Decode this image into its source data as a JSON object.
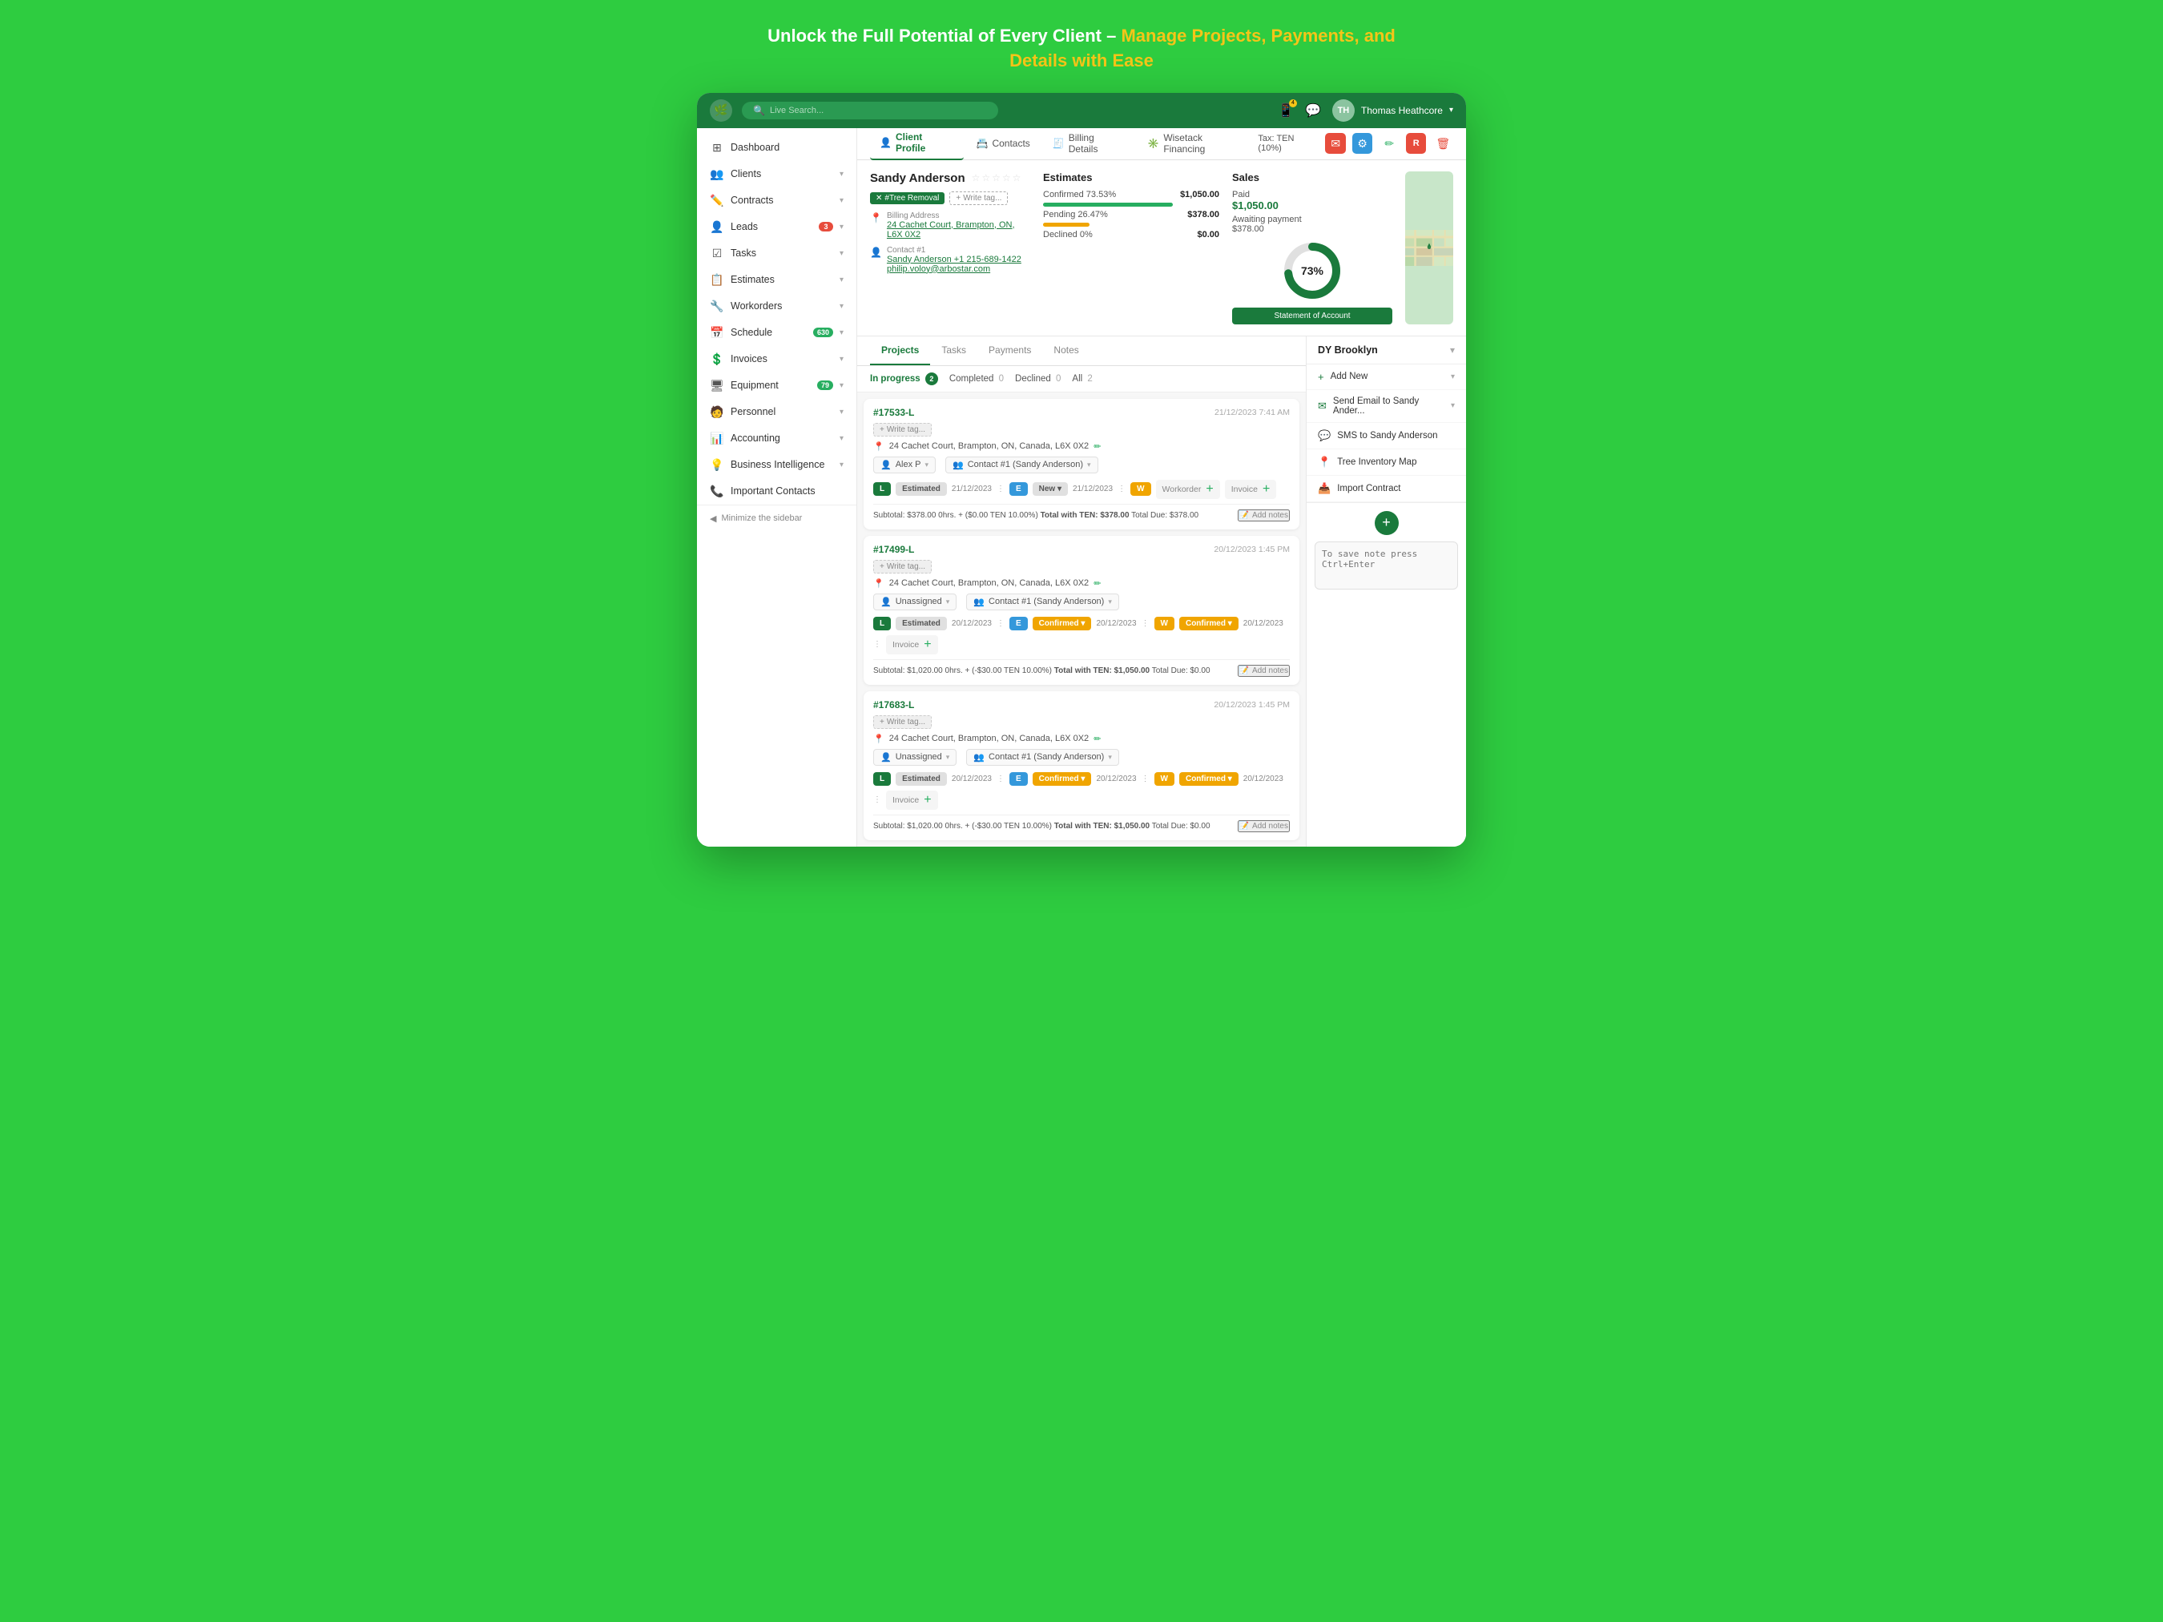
{
  "hero": {
    "title_black": "Unlock the Full Potential of Every Client – ",
    "title_accent": "Manage Projects, Payments, and Details with Ease"
  },
  "topbar": {
    "search_placeholder": "Live Search...",
    "user_name": "Thomas  Heathcore"
  },
  "sidebar": {
    "items": [
      {
        "label": "Dashboard",
        "icon": "⊞",
        "badge": null
      },
      {
        "label": "Clients",
        "icon": "👥",
        "badge": null,
        "arrow": true
      },
      {
        "label": "Contracts",
        "icon": "✏️",
        "badge": null,
        "arrow": true
      },
      {
        "label": "Leads",
        "icon": "👤",
        "badge": "3",
        "arrow": true
      },
      {
        "label": "Tasks",
        "icon": "☑️",
        "badge": null,
        "arrow": true
      },
      {
        "label": "Estimates",
        "icon": "📋",
        "badge": null,
        "arrow": true
      },
      {
        "label": "Workorders",
        "icon": "🔧",
        "badge": null,
        "arrow": true
      },
      {
        "label": "Schedule",
        "icon": "📅",
        "badge": "630",
        "badge_green": true,
        "arrow": true
      },
      {
        "label": "Invoices",
        "icon": "💲",
        "badge": null,
        "arrow": true
      },
      {
        "label": "Equipment",
        "icon": "🖥",
        "badge": "79",
        "badge_green": true,
        "arrow": true
      },
      {
        "label": "Personnel",
        "icon": "🧑",
        "badge": null,
        "arrow": true
      },
      {
        "label": "Accounting",
        "icon": "📊",
        "badge": null,
        "arrow": true
      },
      {
        "label": "Business Intelligence",
        "icon": "💡",
        "badge": null,
        "arrow": true
      },
      {
        "label": "Important Contacts",
        "icon": "📞",
        "badge": null
      }
    ],
    "minimize_label": "Minimize the sidebar"
  },
  "tabs": {
    "items": [
      {
        "label": "Client Profile",
        "icon": "👤",
        "active": true
      },
      {
        "label": "Contacts",
        "icon": "📇",
        "active": false
      },
      {
        "label": "Billing Details",
        "icon": "🧾",
        "active": false
      },
      {
        "label": "Wisetack Financing",
        "icon": "✳️",
        "active": false
      }
    ],
    "tax_label": "Tax: TEN (10%)"
  },
  "client": {
    "name": "Sandy Anderson",
    "stars": "☆☆☆☆☆",
    "tag": "#Tree Removal",
    "write_tag": "+ Write tag...",
    "billing_label": "Billing Address",
    "billing_address": "24 Cachet Court, Brampton, ON, L6X 0X2",
    "contact_label": "Contact #1",
    "contact_name": "Sandy Anderson",
    "contact_phone": "+1 215-689-1422",
    "contact_email": "philip.voloy@arbostar.com"
  },
  "estimates": {
    "title": "Estimates",
    "confirmed_label": "Confirmed 73.53%",
    "confirmed_value": "$1,050.00",
    "confirmed_pct": 73.53,
    "pending_label": "Pending 26.47%",
    "pending_value": "$378.00",
    "pending_pct": 26.47,
    "declined_label": "Declined 0%",
    "declined_value": "$0.00",
    "declined_pct": 0
  },
  "sales": {
    "title": "Sales",
    "paid_label": "Paid",
    "paid_value": "$1,050.00",
    "awaiting_label": "Awaiting payment",
    "awaiting_value": "$378.00",
    "donut_pct": 73,
    "donut_label": "73%",
    "stmt_btn": "Statement of Account"
  },
  "projects_tabs": [
    "Projects",
    "Tasks",
    "Payments",
    "Notes"
  ],
  "filter": {
    "in_progress": "In progress",
    "in_progress_count": "2",
    "completed": "Completed",
    "completed_count": "0",
    "declined": "Declined",
    "declined_count": "0",
    "all": "All",
    "all_count": "2"
  },
  "projects": [
    {
      "id": "#17533-L",
      "date": "21/12/2023 7:41 AM",
      "write_tag": "+ Write tag...",
      "location": "24 Cachet Court, Brampton, ON, Canada, L6X 0X2",
      "assignee": "Alex P",
      "contact": "Contact #1 (Sandy Anderson)",
      "status_l": "Estimated",
      "status_l_date": "21/12/2023",
      "status_e": "New",
      "status_e_date": "21/12/2023",
      "status_w_label": "Workorder",
      "status_invoice": "Invoice",
      "subtotal": "Subtotal: $378.00 0hrs.+ ($0.00 TEN 10.00%)  Total with TEN: $378.00  Total Due: $378.00",
      "add_notes": "Add notes"
    },
    {
      "id": "#17499-L",
      "date": "20/12/2023 1:45 PM",
      "write_tag": "+ Write tag...",
      "location": "24 Cachet Court, Brampton, ON, Canada, L6X 0X2",
      "assignee": "Unassigned",
      "contact": "Contact #1 (Sandy Anderson)",
      "status_l": "Estimated",
      "status_l_date": "20/12/2023",
      "status_e": "Confirmed",
      "status_e_date": "20/12/2023",
      "status_w": "Confirmed",
      "status_w_date": "20/12/2023",
      "status_invoice": "Invoice",
      "subtotal": "Subtotal: $1,020.00 0hrs.+ (-$30.00 TEN 10.00%)  Total with TEN: $1,050.00  Total Due: $0.00",
      "add_notes": "Add notes"
    },
    {
      "id": "#17683-L",
      "date": "20/12/2023 1:45 PM",
      "write_tag": "+ Write tag...",
      "location": "24 Cachet Court, Brampton, ON, Canada, L6X 0X2",
      "assignee": "Unassigned",
      "contact": "Contact #1 (Sandy Anderson)",
      "status_l": "Estimated",
      "status_l_date": "20/12/2023",
      "status_e": "Confirmed",
      "status_e_date": "20/12/2023",
      "status_w": "Confirmed",
      "status_w_date": "20/12/2023",
      "status_invoice": "Invoice",
      "subtotal": "Subtotal: $1,020.00 0hrs.+ (-$30.00 TEN 10.00%)  Total with TEN: $1,050.00  Total Due: $0.00",
      "add_notes": "Add notes"
    }
  ],
  "right_sidebar": {
    "branch": "DY Brooklyn",
    "actions": [
      {
        "label": "Add New",
        "icon": "+"
      },
      {
        "label": "Send Email to Sandy Ander...",
        "icon": "✉"
      },
      {
        "label": "SMS to Sandy Anderson",
        "icon": "💬"
      },
      {
        "label": "Tree Inventory Map",
        "icon": "🗺"
      },
      {
        "label": "Import Contract",
        "icon": "📥"
      }
    ],
    "note_placeholder": "To save note press Ctrl+Enter"
  }
}
